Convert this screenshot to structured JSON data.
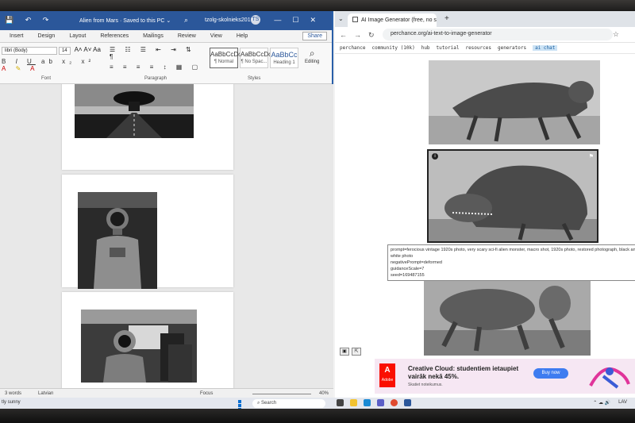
{
  "word": {
    "title_icons": [
      "💾",
      "↶",
      "↷"
    ],
    "doc_title": "Alien from Mars  ·  Saved to this PC ⌄",
    "user_name": "tzolg-skolnieks2016",
    "user_initials": "TS",
    "tabs": [
      "Insert",
      "Design",
      "Layout",
      "References",
      "Mailings",
      "Review",
      "View",
      "Help"
    ],
    "share_label": "Share",
    "font_name": "libri (Body)",
    "font_size": "14",
    "styles": [
      {
        "sample": "AaBbCcDc",
        "name": "¶ Normal"
      },
      {
        "sample": "AaBbCcDc",
        "name": "¶ No Spac..."
      },
      {
        "sample": "AaBbCc",
        "name": "Heading 1"
      }
    ],
    "editing_label": "Editing",
    "group_labels": {
      "font": "Font",
      "paragraph": "Paragraph",
      "styles": "Styles"
    },
    "status": {
      "words": "3 words",
      "language": "Latvian",
      "focus": "Focus",
      "zoom": "40%"
    }
  },
  "browser": {
    "tab_title": "AI Image Generator (free, no s",
    "url": "perchance.org/ai-text-to-image-generator",
    "bookmarks": [
      "perchance",
      "community (10k)",
      "hub",
      "tutorial",
      "resources",
      "generators",
      "ai chat"
    ],
    "tooltip": {
      "prompt": "prompt=ferocious vintage 1920s photo, very scary sci-fi alien monster, macro shot, 1920s photo, restored photograph, black and white photo",
      "negative": "negativePrompt=deformed",
      "guidance": "guidanceScale=7",
      "seed": "seed=169487155"
    },
    "ad": {
      "brand": "Adobe",
      "headline": "Creative Cloud: studentiem ietaupiet vairāk nekā 45%.",
      "subline": "Skatiet noteikumus.",
      "button": "Buy now"
    }
  },
  "taskbar": {
    "weather": "tly sunny",
    "search": "Search",
    "lang": "LAV",
    "tray_icons": "⌃  ☁  🔊"
  },
  "colors": {
    "word_blue": "#2b579a",
    "chrome_tab_bg": "#dfe3e8",
    "ad_bg": "#f6e7f3",
    "adobe_red": "#fa0f00",
    "buy_blue": "#3e7cf0"
  }
}
